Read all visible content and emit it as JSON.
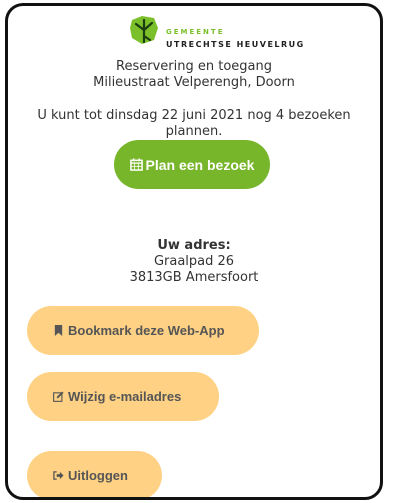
{
  "logo": {
    "line1": "GEMEENTE",
    "line2": "UTRECHTSE HEUVELRUG",
    "brand_color": "#7bbf2a"
  },
  "header": {
    "line1": "Reservering en toegang",
    "line2": "Milieustraat Velperengh, Doorn"
  },
  "info_text": "U kunt tot dinsdag 22 juni 2021 nog 4 bezoeken plannen.",
  "plan_button": {
    "label": "Plan een bezoek",
    "icon": "calendar-icon",
    "color": "#77b52a"
  },
  "address": {
    "title": "Uw adres:",
    "street": "Graalpad 26",
    "city": "3813GB Amersfoort"
  },
  "actions": {
    "bookmark_label": "Bookmark deze Web-App",
    "bookmark_icon": "bookmark-icon",
    "email_label": "Wijzig e-mailadres",
    "email_icon": "edit-icon",
    "logout_label": "Uitloggen",
    "logout_icon": "sign-out-icon",
    "color": "#fed184"
  }
}
